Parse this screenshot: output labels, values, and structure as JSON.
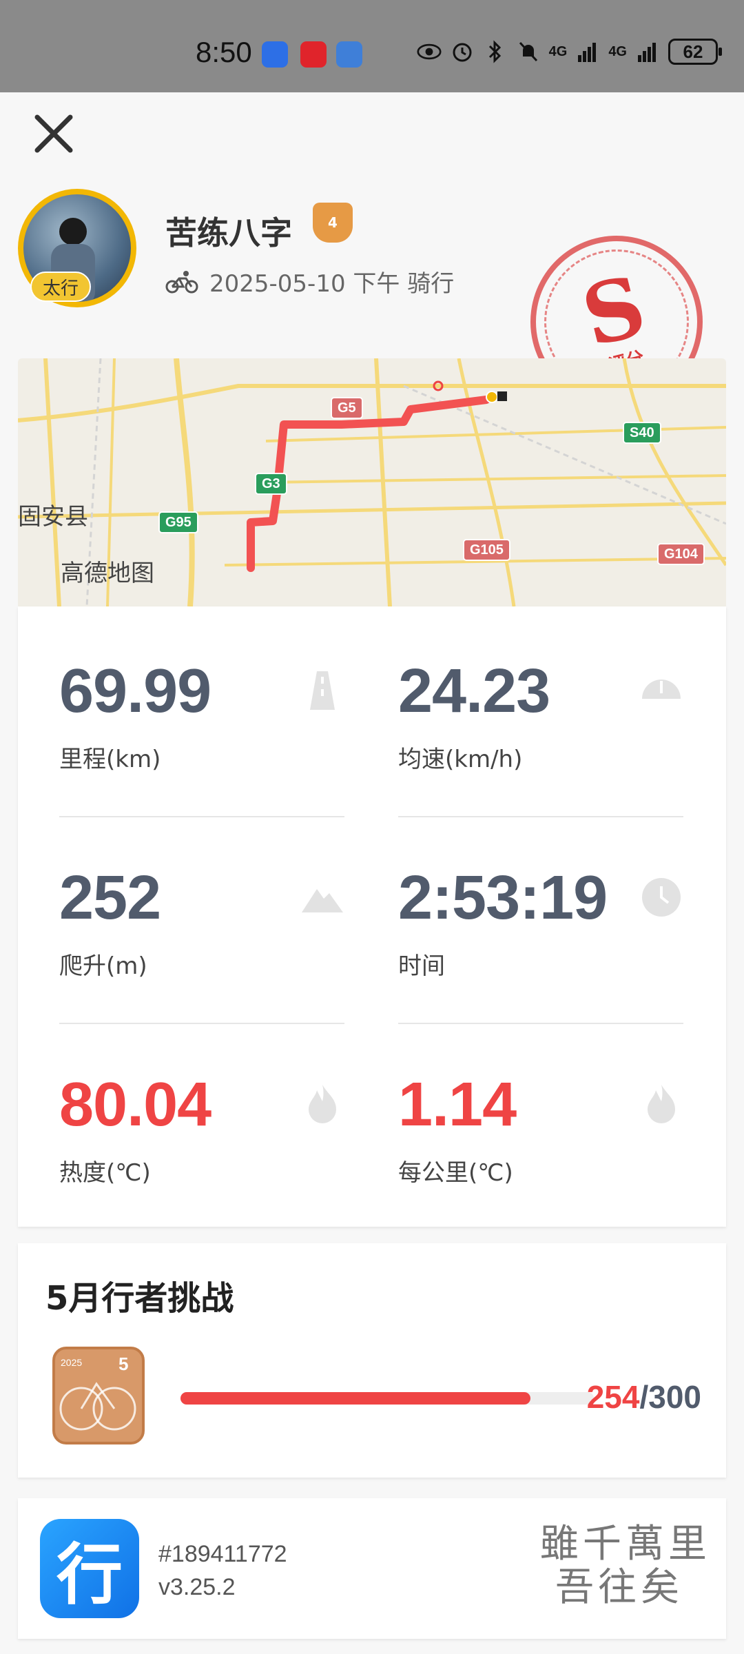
{
  "status_bar": {
    "time": "8:50",
    "net1": "4G",
    "net2": "4G",
    "battery": "62"
  },
  "profile": {
    "username": "苦练八字",
    "avatar_badge": "太行",
    "level": "4",
    "date_text": "2025-05-10 下午 骑行"
  },
  "stamp": {
    "letter": "S",
    "label": "评分"
  },
  "map": {
    "labels": [
      "固安县",
      "高德地图"
    ],
    "road_tags": [
      "G95",
      "G3",
      "G105",
      "G104",
      "S40"
    ],
    "colors": {
      "route": "#f25252",
      "road": "#f5d97a",
      "background": "#f1eee6"
    }
  },
  "stats": [
    {
      "value": "69.99",
      "label": "里程(km)",
      "icon": "road-icon",
      "accent": false
    },
    {
      "value": "24.23",
      "label": "均速(km/h)",
      "icon": "speedometer-icon",
      "accent": false
    },
    {
      "value": "252",
      "label": "爬升(m)",
      "icon": "mountain-icon",
      "accent": false
    },
    {
      "value": "2:53:19",
      "label": "时间",
      "icon": "clock-icon",
      "accent": false
    },
    {
      "value": "80.04",
      "label": "热度(℃)",
      "icon": "flame-icon",
      "accent": true
    },
    {
      "value": "1.14",
      "label": "每公里(℃)",
      "icon": "flame-icon",
      "accent": true
    }
  ],
  "challenge": {
    "title": "5月行者挑战",
    "current": "254",
    "total": "/300",
    "progress_fraction": 0.847,
    "medal_year": "2025",
    "medal_month": "5"
  },
  "footer": {
    "app_icon_text": "行",
    "id_text": "#189411772",
    "version": "v3.25.2",
    "calligraphy_line1": "雖千萬里",
    "calligraphy_line2": "吾往矣"
  }
}
